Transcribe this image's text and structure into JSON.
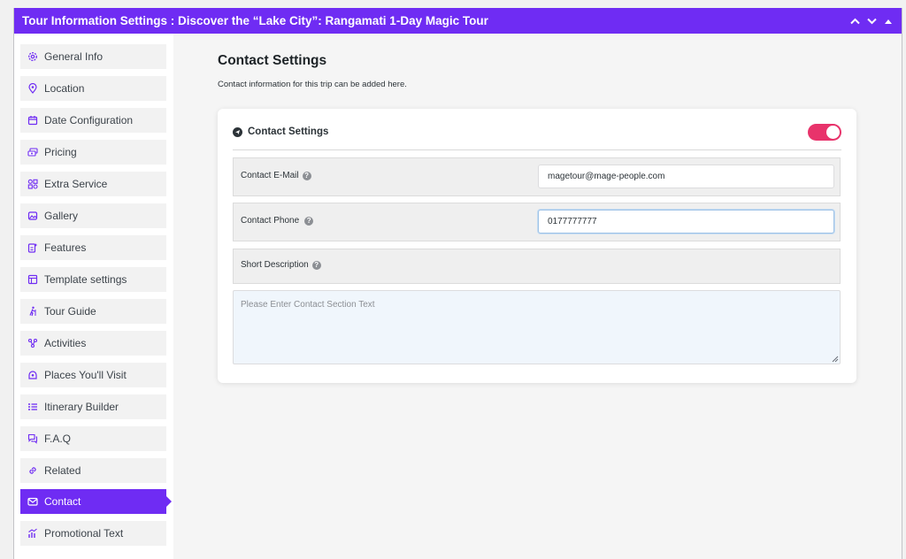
{
  "header": {
    "title": "Tour Information Settings : Discover the “Lake City”: Rangamati 1-Day Magic Tour",
    "bg_color": "#6f2cf3"
  },
  "sidebar": {
    "active_color": "#6f2cf3",
    "items": [
      {
        "label": "General Info",
        "icon": "gear-icon"
      },
      {
        "label": "Location",
        "icon": "map-pin-icon"
      },
      {
        "label": "Date Configuration",
        "icon": "calendar-icon"
      },
      {
        "label": "Pricing",
        "icon": "money-icon"
      },
      {
        "label": "Extra Service",
        "icon": "grid-plus-icon"
      },
      {
        "label": "Gallery",
        "icon": "image-icon"
      },
      {
        "label": "Features",
        "icon": "features-icon"
      },
      {
        "label": "Template settings",
        "icon": "layout-icon"
      },
      {
        "label": "Tour Guide",
        "icon": "hiker-icon"
      },
      {
        "label": "Activities",
        "icon": "activities-icon"
      },
      {
        "label": "Places You'll Visit",
        "icon": "place-icon"
      },
      {
        "label": "Itinerary Builder",
        "icon": "list-icon"
      },
      {
        "label": "F.A.Q",
        "icon": "faq-icon"
      },
      {
        "label": "Related",
        "icon": "link-icon"
      },
      {
        "label": "Contact",
        "icon": "mail-icon",
        "active": true
      },
      {
        "label": "Promotional Text",
        "icon": "chart-icon"
      }
    ]
  },
  "main": {
    "title": "Contact Settings",
    "description": "Contact information for this trip can be added here.",
    "card": {
      "heading": "Contact Settings",
      "toggle_on": true,
      "toggle_color": "#e8336b",
      "email_label": "Contact E-Mail",
      "email_value": "magetour@mage-people.com",
      "phone_label": "Contact Phone",
      "phone_value": "0177777777",
      "short_desc_label": "Short Description",
      "textarea_placeholder": "Please Enter Contact Section Text"
    }
  }
}
